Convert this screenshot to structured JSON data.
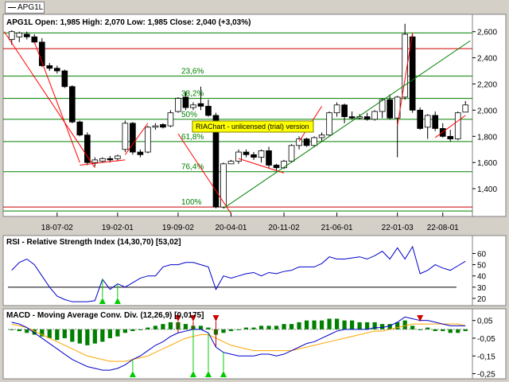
{
  "symbol_tag": "APG1L",
  "watermark": "RIAChart - unlicensed (trial) version",
  "colors": {
    "up_candle": "#ffffff",
    "down_candle": "#000000",
    "bb_lines": "#008000",
    "fib_lines": "#008000",
    "trend_lines": "#ff0000",
    "rsi_line": "#0000cc",
    "macd_line": "#0000cc",
    "signal_line": "#ffa500",
    "histogram": "#008000",
    "buy_arrow": "#00cc00",
    "sell_arrow": "#cc0000"
  },
  "chart_data": [
    {
      "type": "candlestick",
      "title": "APG1L Open: 1,985  High: 2,070  Low: 1,985  Close: 2,040 (+3,03%)",
      "x_tick_labels": [
        "18-07-02",
        "19-02-01",
        "19-09-02",
        "20-04-01",
        "20-11-02",
        "21-06-01",
        "22-01-03",
        "22-08-01"
      ],
      "y_tick_labels": [
        "2,600",
        "2,400",
        "2,200",
        "2,000",
        "1,800",
        "1,600",
        "1,400"
      ],
      "ylim": [
        1200,
        2720
      ],
      "candles": [
        {
          "o": 2540,
          "h": 2610,
          "l": 2500,
          "c": 2600
        },
        {
          "o": 2560,
          "h": 2600,
          "l": 2520,
          "c": 2590
        },
        {
          "o": 2580,
          "h": 2600,
          "l": 2540,
          "c": 2560
        },
        {
          "o": 2560,
          "h": 2580,
          "l": 2510,
          "c": 2520
        },
        {
          "o": 2520,
          "h": 2550,
          "l": 2330,
          "c": 2340
        },
        {
          "o": 2340,
          "h": 2360,
          "l": 2300,
          "c": 2320
        },
        {
          "o": 2320,
          "h": 2340,
          "l": 2280,
          "c": 2300
        },
        {
          "o": 2300,
          "h": 2310,
          "l": 2170,
          "c": 2180
        },
        {
          "o": 2180,
          "h": 2190,
          "l": 1900,
          "c": 1910
        },
        {
          "o": 1910,
          "h": 1920,
          "l": 1800,
          "c": 1810
        },
        {
          "o": 1810,
          "h": 1830,
          "l": 1580,
          "c": 1600
        },
        {
          "o": 1600,
          "h": 1640,
          "l": 1570,
          "c": 1620
        },
        {
          "o": 1610,
          "h": 1640,
          "l": 1600,
          "c": 1630
        },
        {
          "o": 1630,
          "h": 1650,
          "l": 1600,
          "c": 1620
        },
        {
          "o": 1630,
          "h": 1660,
          "l": 1610,
          "c": 1650
        },
        {
          "o": 1700,
          "h": 1920,
          "l": 1680,
          "c": 1900
        },
        {
          "o": 1900,
          "h": 1910,
          "l": 1660,
          "c": 1680
        },
        {
          "o": 1680,
          "h": 1700,
          "l": 1640,
          "c": 1660
        },
        {
          "o": 1680,
          "h": 1880,
          "l": 1670,
          "c": 1870
        },
        {
          "o": 1870,
          "h": 1900,
          "l": 1850,
          "c": 1880
        },
        {
          "o": 1890,
          "h": 1900,
          "l": 1860,
          "c": 1870
        },
        {
          "o": 1880,
          "h": 2000,
          "l": 1870,
          "c": 1980
        },
        {
          "o": 1990,
          "h": 2100,
          "l": 1980,
          "c": 2090
        },
        {
          "o": 2100,
          "h": 2140,
          "l": 2000,
          "c": 2020
        },
        {
          "o": 2020,
          "h": 2060,
          "l": 2000,
          "c": 2040
        },
        {
          "o": 2050,
          "h": 2180,
          "l": 2000,
          "c": 2030
        },
        {
          "o": 2030,
          "h": 2080,
          "l": 1950,
          "c": 1960
        },
        {
          "o": 1960,
          "h": 1980,
          "l": 1250,
          "c": 1260
        },
        {
          "o": 1260,
          "h": 1600,
          "l": 1250,
          "c": 1590
        },
        {
          "o": 1590,
          "h": 1620,
          "l": 1600,
          "c": 1610
        },
        {
          "o": 1610,
          "h": 1700,
          "l": 1590,
          "c": 1680
        },
        {
          "o": 1680,
          "h": 1700,
          "l": 1640,
          "c": 1660
        },
        {
          "o": 1660,
          "h": 1680,
          "l": 1620,
          "c": 1640
        },
        {
          "o": 1640,
          "h": 1700,
          "l": 1600,
          "c": 1690
        },
        {
          "o": 1690,
          "h": 1720,
          "l": 1560,
          "c": 1580
        },
        {
          "o": 1580,
          "h": 1590,
          "l": 1540,
          "c": 1560
        },
        {
          "o": 1560,
          "h": 1620,
          "l": 1550,
          "c": 1610
        },
        {
          "o": 1610,
          "h": 1740,
          "l": 1600,
          "c": 1730
        },
        {
          "o": 1730,
          "h": 1800,
          "l": 1700,
          "c": 1780
        },
        {
          "o": 1780,
          "h": 1790,
          "l": 1720,
          "c": 1730
        },
        {
          "o": 1730,
          "h": 1800,
          "l": 1720,
          "c": 1790
        },
        {
          "o": 1790,
          "h": 1830,
          "l": 1760,
          "c": 1810
        },
        {
          "o": 1810,
          "h": 1990,
          "l": 1800,
          "c": 1980
        },
        {
          "o": 1980,
          "h": 2060,
          "l": 1950,
          "c": 2040
        },
        {
          "o": 2040,
          "h": 2050,
          "l": 1900,
          "c": 1950
        },
        {
          "o": 1950,
          "h": 1990,
          "l": 1930,
          "c": 1940
        },
        {
          "o": 1940,
          "h": 1970,
          "l": 1930,
          "c": 1950
        },
        {
          "o": 1950,
          "h": 1980,
          "l": 1920,
          "c": 1930
        },
        {
          "o": 1930,
          "h": 2000,
          "l": 1920,
          "c": 1990
        },
        {
          "o": 1990,
          "h": 2090,
          "l": 1940,
          "c": 2080
        },
        {
          "o": 2080,
          "h": 2120,
          "l": 1930,
          "c": 1940
        },
        {
          "o": 1940,
          "h": 2110,
          "l": 1640,
          "c": 2100
        },
        {
          "o": 2100,
          "h": 2660,
          "l": 2080,
          "c": 2580
        },
        {
          "o": 2560,
          "h": 2580,
          "l": 1980,
          "c": 2000
        },
        {
          "o": 2000,
          "h": 2020,
          "l": 1850,
          "c": 1860
        },
        {
          "o": 1870,
          "h": 1970,
          "l": 1780,
          "c": 1960
        },
        {
          "o": 1960,
          "h": 1990,
          "l": 1840,
          "c": 1860
        },
        {
          "o": 1860,
          "h": 1900,
          "l": 1790,
          "c": 1800
        },
        {
          "o": 1800,
          "h": 1850,
          "l": 1760,
          "c": 1780
        },
        {
          "o": 1780,
          "h": 1990,
          "l": 1770,
          "c": 1980
        },
        {
          "o": 1985,
          "h": 2070,
          "l": 1985,
          "c": 2040
        }
      ],
      "horizontal_lines": [
        {
          "y": 2470,
          "color": "#cc0000",
          "label": ""
        },
        {
          "y": 2590,
          "color": "#008000",
          "label": ""
        },
        {
          "y": 2260,
          "color": "#008000",
          "label": "23,6%"
        },
        {
          "y": 2090,
          "color": "#008000",
          "label": "38,2%"
        },
        {
          "y": 1930,
          "color": "#008000",
          "label": "50%"
        },
        {
          "y": 1760,
          "color": "#008000",
          "label": "61,8%"
        },
        {
          "y": 1530,
          "color": "#008000",
          "label": "76,4%"
        },
        {
          "y": 1260,
          "color": "#cc0000",
          "label": "100%"
        },
        {
          "y": 1230,
          "color": "#008000",
          "label": ""
        }
      ]
    },
    {
      "type": "line",
      "title": "RSI - Relative Strength Index (14,30,70) [53,02]",
      "y_tick_labels": [
        "60",
        "50",
        "40",
        "30",
        "20"
      ],
      "ylim": [
        15,
        66
      ],
      "reference_levels": [
        30
      ],
      "values": [
        45,
        52,
        55,
        50,
        40,
        30,
        22,
        19,
        17,
        17,
        17,
        18,
        37,
        28,
        33,
        30,
        34,
        38,
        40,
        40,
        48,
        50,
        50,
        52,
        52,
        50,
        48,
        28,
        40,
        38,
        40,
        42,
        43,
        40,
        43,
        42,
        44,
        45,
        48,
        48,
        48,
        51,
        57,
        55,
        55,
        56,
        57,
        55,
        58,
        62,
        55,
        65,
        55,
        66,
        42,
        45,
        50,
        47,
        45,
        49,
        53
      ],
      "buy_signals": [
        12,
        14
      ]
    },
    {
      "type": "bar",
      "title": "MACD - Moving Average Conv. Div. (12,26,9) [0,0175]",
      "y_tick_labels": [
        "0,05",
        "-0,05",
        "-0,15",
        "-0,25"
      ],
      "ylim": [
        -0.27,
        0.08
      ],
      "histogram": [
        0.0,
        -0.01,
        -0.02,
        -0.03,
        -0.04,
        -0.05,
        -0.06,
        -0.05,
        -0.07,
        -0.08,
        -0.09,
        -0.08,
        -0.07,
        -0.05,
        -0.04,
        -0.02,
        -0.01,
        0.0,
        0.01,
        0.02,
        0.03,
        0.04,
        0.04,
        0.03,
        0.02,
        0.02,
        0.01,
        -0.03,
        -0.02,
        -0.01,
        0.0,
        0.01,
        0.01,
        0.02,
        0.02,
        0.02,
        0.03,
        0.03,
        0.04,
        0.05,
        0.05,
        0.05,
        0.06,
        0.06,
        0.05,
        0.05,
        0.04,
        0.04,
        0.04,
        0.03,
        0.03,
        0.04,
        0.05,
        0.02,
        0.0,
        0.01,
        -0.01,
        -0.01,
        -0.02,
        -0.02,
        -0.01
      ],
      "macd": [
        0.04,
        0.03,
        0.01,
        -0.02,
        -0.05,
        -0.08,
        -0.11,
        -0.14,
        -0.17,
        -0.19,
        -0.21,
        -0.22,
        -0.23,
        -0.23,
        -0.22,
        -0.2,
        -0.17,
        -0.15,
        -0.12,
        -0.09,
        -0.07,
        -0.04,
        -0.02,
        -0.01,
        0.0,
        0.0,
        -0.02,
        -0.1,
        -0.13,
        -0.14,
        -0.15,
        -0.15,
        -0.15,
        -0.14,
        -0.14,
        -0.15,
        -0.14,
        -0.12,
        -0.1,
        -0.08,
        -0.07,
        -0.05,
        -0.03,
        -0.01,
        0.0,
        0.0,
        0.0,
        0.0,
        0.01,
        0.01,
        0.02,
        0.04,
        0.07,
        0.06,
        0.05,
        0.05,
        0.04,
        0.03,
        0.02,
        0.02,
        0.02
      ],
      "signal": [
        0.03,
        0.02,
        0.01,
        -0.01,
        -0.03,
        -0.05,
        -0.07,
        -0.09,
        -0.11,
        -0.13,
        -0.15,
        -0.16,
        -0.17,
        -0.18,
        -0.18,
        -0.18,
        -0.17,
        -0.16,
        -0.15,
        -0.13,
        -0.11,
        -0.09,
        -0.07,
        -0.05,
        -0.04,
        -0.03,
        -0.03,
        -0.05,
        -0.07,
        -0.09,
        -0.1,
        -0.11,
        -0.12,
        -0.12,
        -0.12,
        -0.12,
        -0.12,
        -0.12,
        -0.11,
        -0.1,
        -0.09,
        -0.08,
        -0.07,
        -0.06,
        -0.05,
        -0.04,
        -0.03,
        -0.02,
        -0.01,
        -0.01,
        0.0,
        0.01,
        0.02,
        0.03,
        0.03,
        0.03,
        0.03,
        0.03,
        0.03,
        0.03,
        0.02
      ],
      "buy_signals": [
        16,
        24,
        26,
        28
      ],
      "sell_signals": [
        22,
        24,
        27,
        54
      ]
    }
  ]
}
